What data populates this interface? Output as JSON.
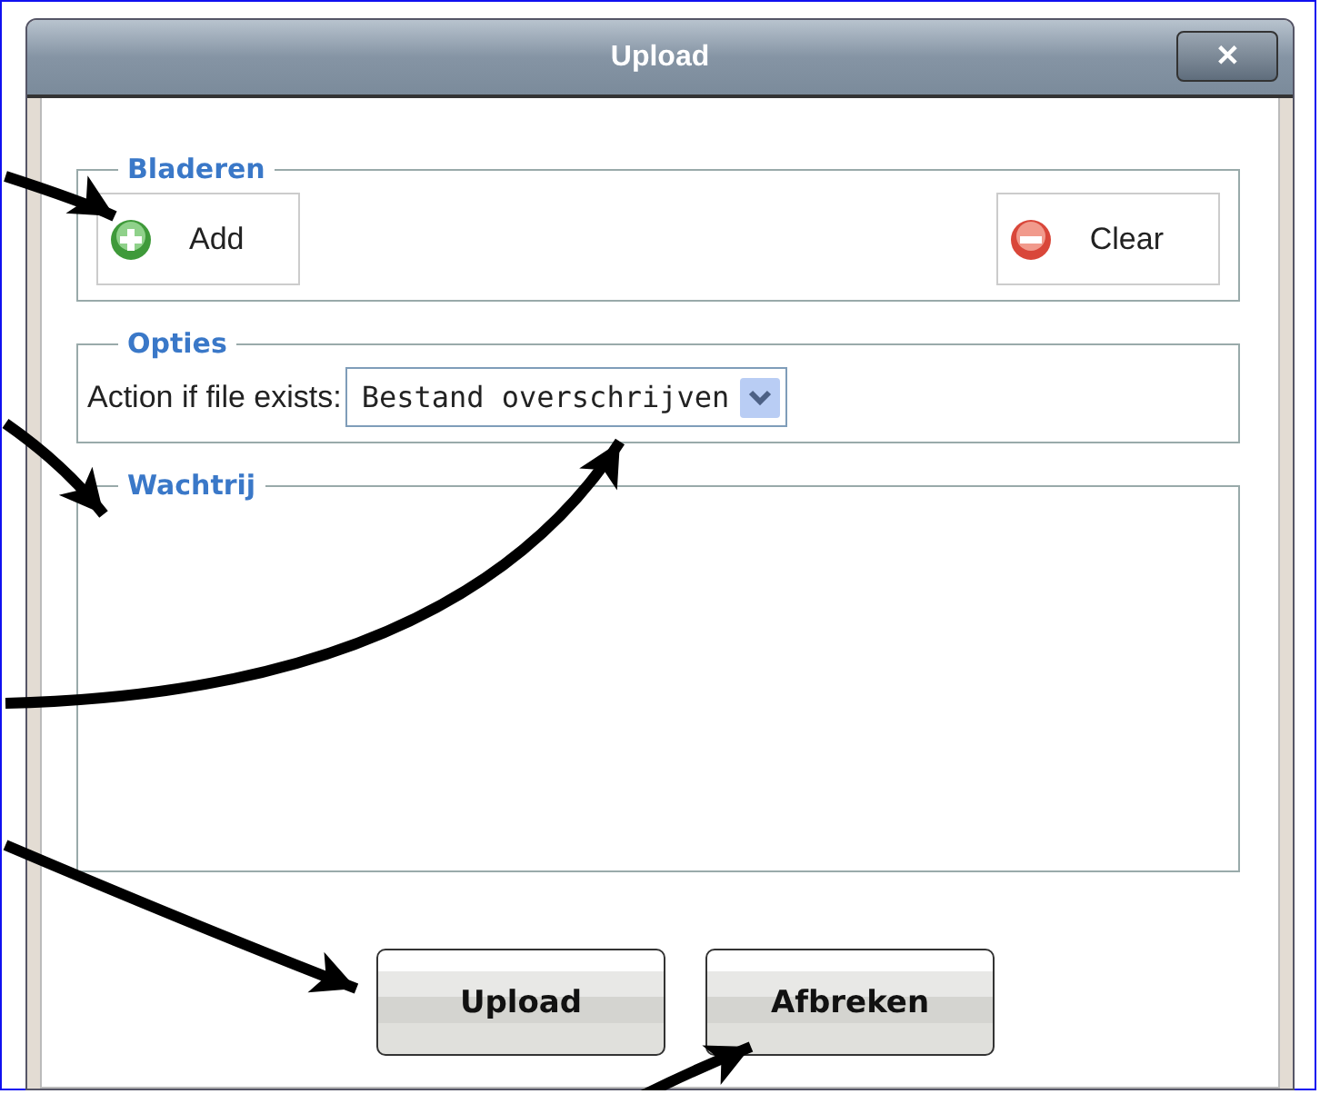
{
  "window": {
    "title": "Upload",
    "close_icon": "✕"
  },
  "browse": {
    "legend": "Bladeren",
    "buttons": [
      {
        "kind": "add",
        "label": "Add"
      },
      {
        "kind": "clear",
        "label": "Clear"
      }
    ]
  },
  "options": {
    "legend": "Opties",
    "label": "Action if file exists:",
    "value": "Bestand overschrijven"
  },
  "queue": {
    "legend": "Wachtrij"
  },
  "buttons": [
    "Upload",
    "Afbreken"
  ]
}
